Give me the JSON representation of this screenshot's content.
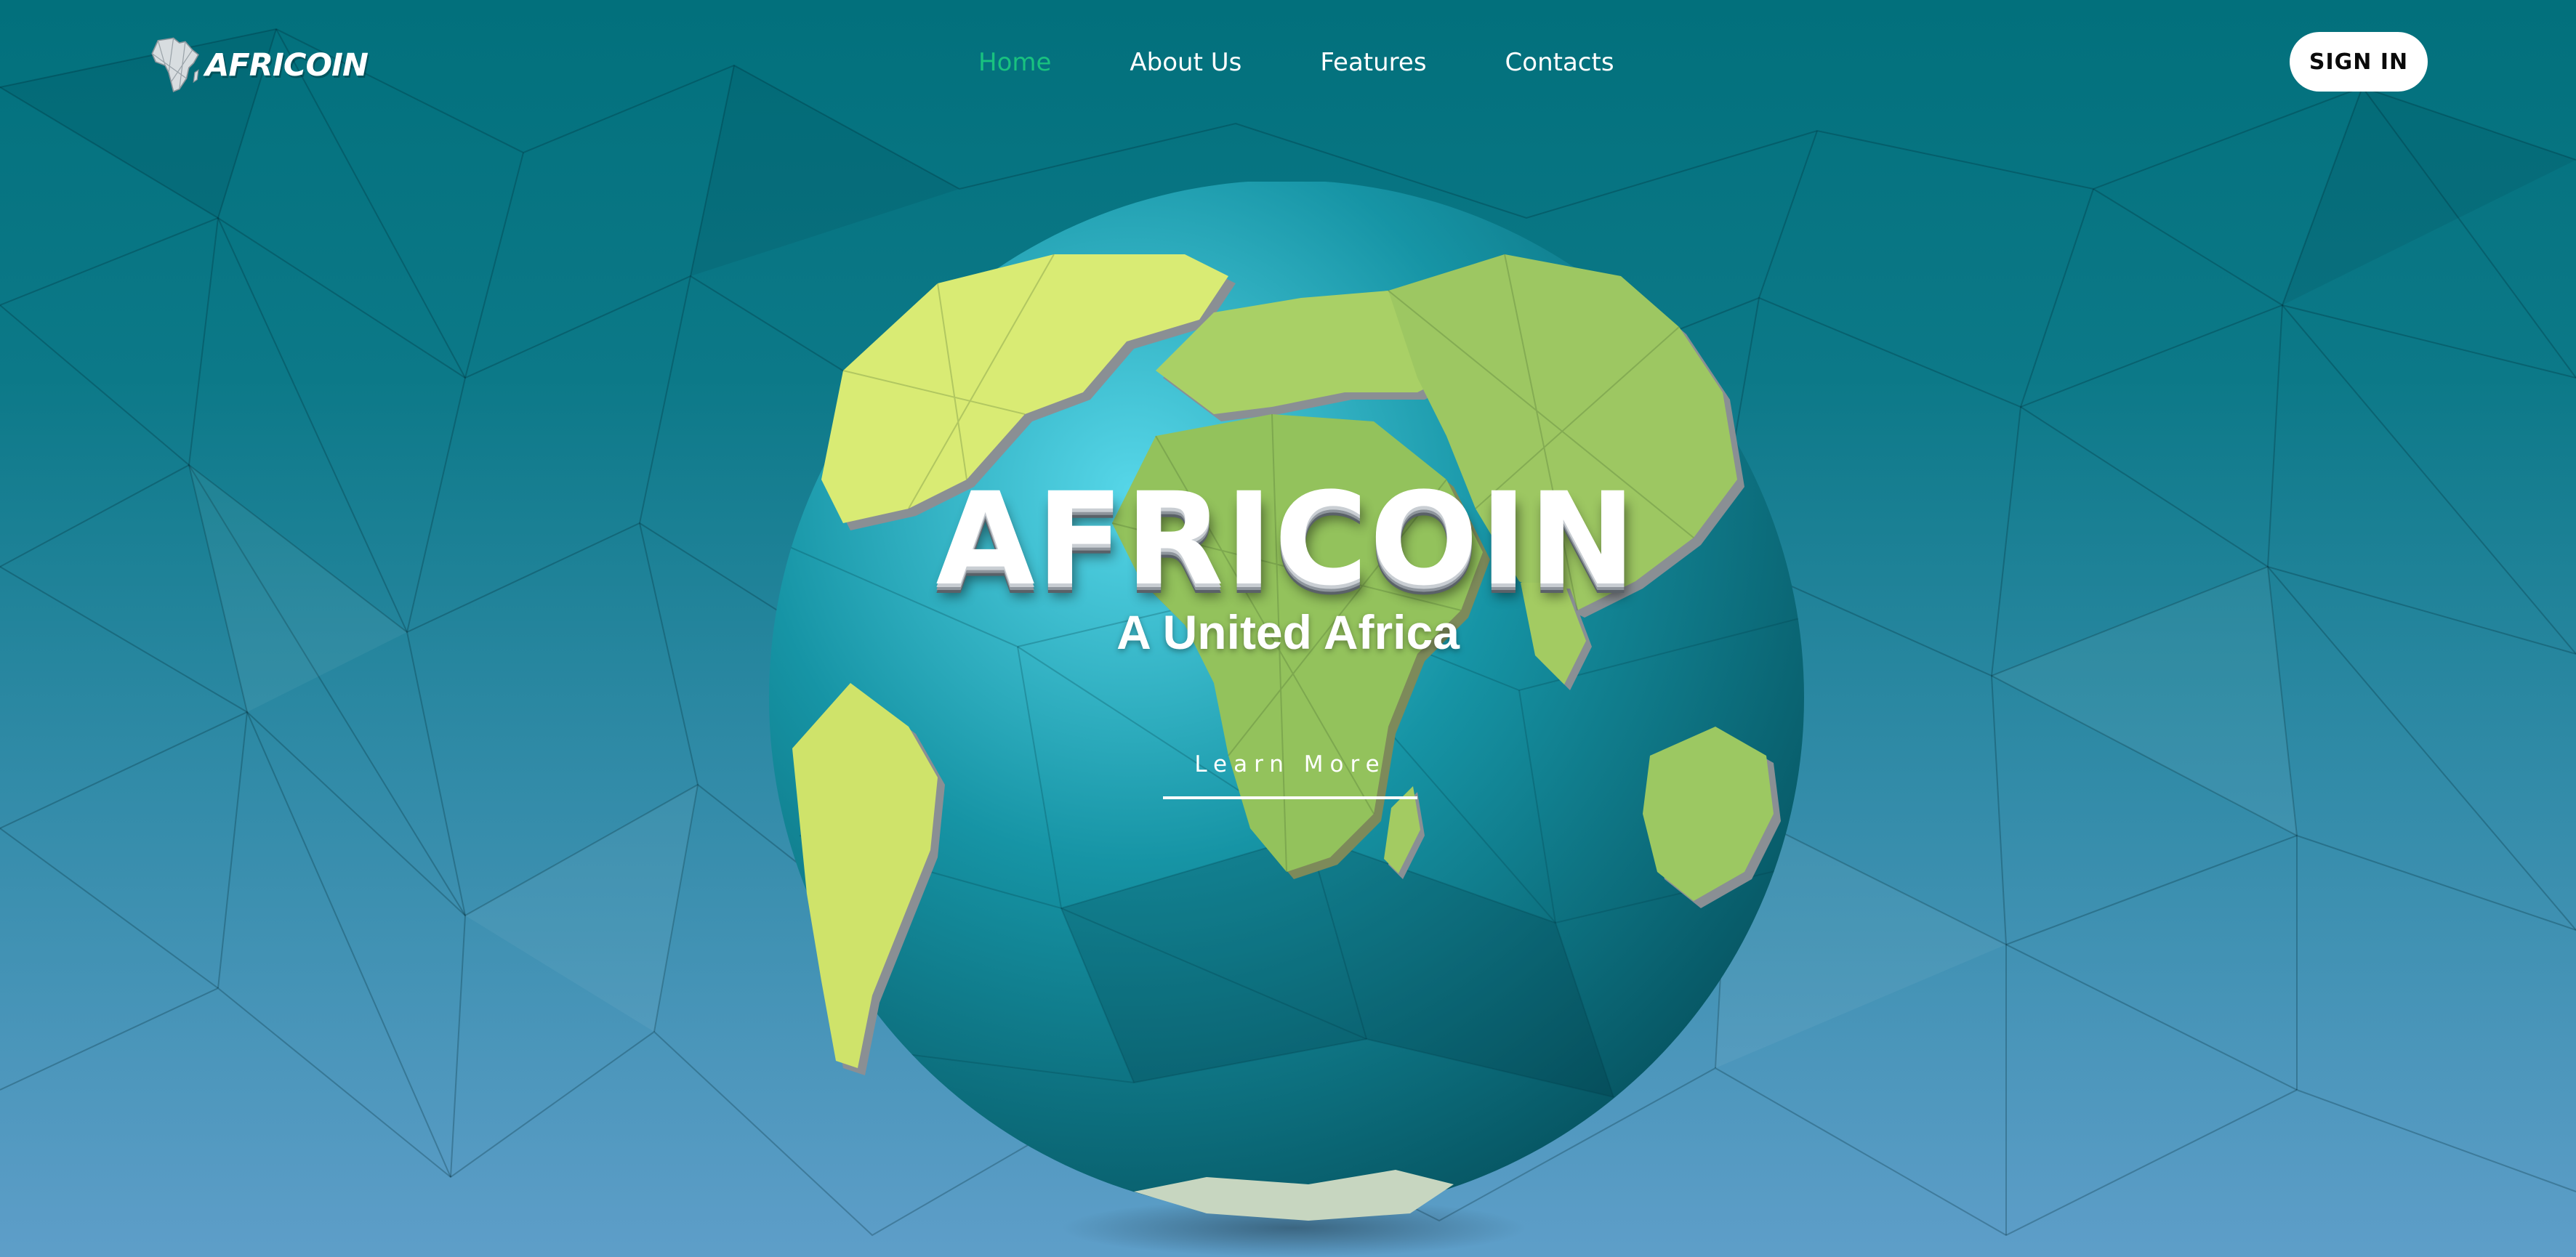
{
  "brand": {
    "logo_text": "AFRICOIN"
  },
  "nav": {
    "links": [
      {
        "label": "Home",
        "active": true
      },
      {
        "label": "About Us",
        "active": false
      },
      {
        "label": "Features",
        "active": false
      },
      {
        "label": "Contacts",
        "active": false
      }
    ],
    "sign_in_label": "SIGN IN"
  },
  "hero": {
    "title": "AFRICOIN",
    "subtitle": "A United Africa",
    "cta_label": "Learn More"
  },
  "colors": {
    "accent_active": "#19c27f",
    "background_top": "#02707c",
    "background_bottom": "#5e9ec9",
    "land": "#9fc95a",
    "ocean": "#0f8796"
  }
}
